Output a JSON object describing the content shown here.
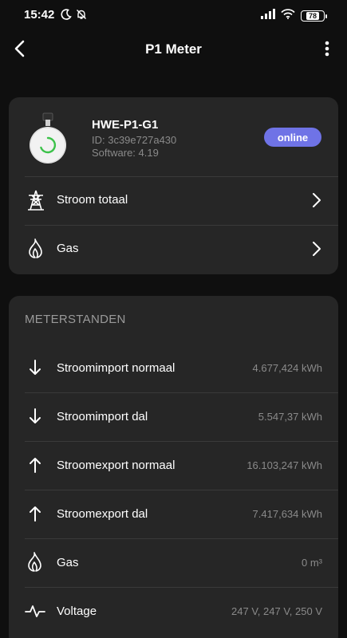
{
  "status_bar": {
    "time": "15:42",
    "battery": "78",
    "icons": [
      "moon-icon",
      "bell-off-icon",
      "signal-icon",
      "wifi-icon",
      "battery-icon"
    ]
  },
  "header": {
    "title": "P1 Meter",
    "back_icon": "chevron-left-icon",
    "more_icon": "more-vertical-icon"
  },
  "device": {
    "name": "HWE-P1-G1",
    "id": "ID: 3c39e727a430",
    "software": "Software: 4.19",
    "status": "online",
    "status_color": "#6f73e6"
  },
  "nav_items": [
    {
      "label": "Stroom totaal",
      "icon": "power-tower-icon"
    },
    {
      "label": "Gas",
      "icon": "flame-icon"
    }
  ],
  "meter": {
    "title": "METERSTANDEN",
    "rows": [
      {
        "label": "Stroomimport normaal",
        "value": "4.677,424 kWh",
        "icon": "arrow-down-icon"
      },
      {
        "label": "Stroomimport dal",
        "value": "5.547,37 kWh",
        "icon": "arrow-down-icon"
      },
      {
        "label": "Stroomexport normaal",
        "value": "16.103,247 kWh",
        "icon": "arrow-up-icon"
      },
      {
        "label": "Stroomexport dal",
        "value": "7.417,634 kWh",
        "icon": "arrow-up-icon"
      },
      {
        "label": "Gas",
        "value": "0 m³",
        "icon": "flame-icon"
      },
      {
        "label": "Voltage",
        "value": "247 V, 247 V, 250 V",
        "icon": "pulse-icon"
      }
    ]
  }
}
